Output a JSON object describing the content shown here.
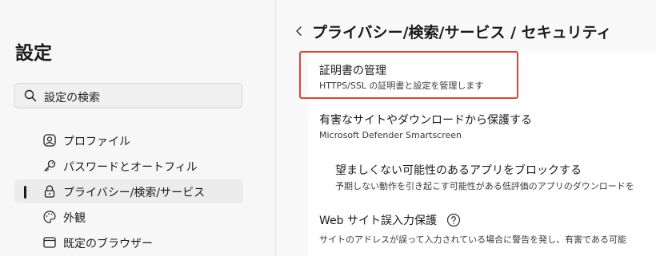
{
  "sidebar": {
    "title": "設定",
    "search_placeholder": "設定の検索",
    "items": [
      {
        "label": "プロファイル",
        "icon": "profile-icon"
      },
      {
        "label": "パスワードとオートフィル",
        "icon": "key-icon"
      },
      {
        "label": "プライバシー/検索/サービス",
        "icon": "lock-icon",
        "selected": true
      },
      {
        "label": "外観",
        "icon": "palette-icon"
      },
      {
        "label": "既定のブラウザー",
        "icon": "browser-window-icon"
      }
    ]
  },
  "main": {
    "breadcrumb": "プライバシー/検索/サービス  /  セキュリティ",
    "rows": [
      {
        "title": "証明書の管理",
        "subtitle": "HTTPS/SSL の証明書と設定を管理します"
      },
      {
        "title": "有害なサイトやダウンロードから保護する",
        "subtitle": "Microsoft Defender Smartscreen"
      },
      {
        "title": "望ましくない可能性のあるアプリをブロックする",
        "subtitle": "予期しない動作を引き起こす可能性がある低評価のアプリのダウンロードを"
      },
      {
        "title": "Web サイト誤入力保護",
        "subtitle": "サイトのアドレスが誤って入力されている場合に警告を発し、有害である可能"
      }
    ]
  },
  "colors": {
    "highlight": "#e0443a",
    "selected_bg": "#ececec"
  }
}
